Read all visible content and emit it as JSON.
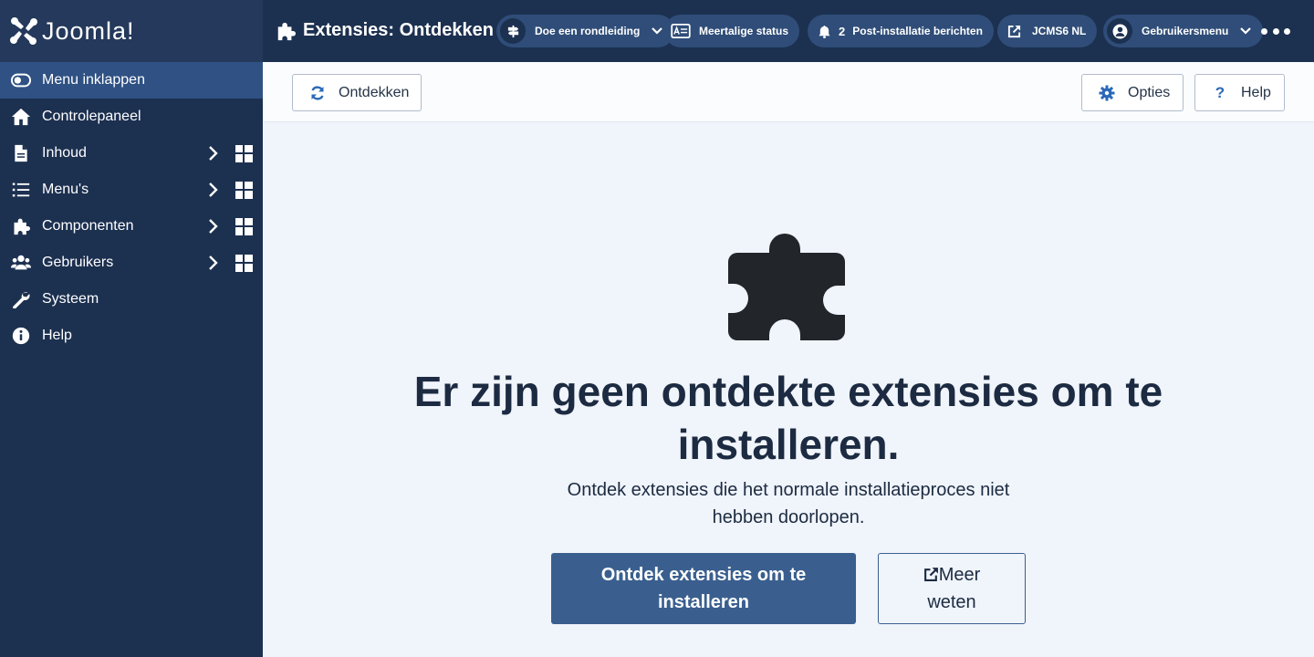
{
  "brand": {
    "name": "Joomla!"
  },
  "sidebar": {
    "items": [
      {
        "label": "Menu inklappen",
        "icon": "toggle-icon"
      },
      {
        "label": "Controlepaneel",
        "icon": "home-icon"
      },
      {
        "label": "Inhoud",
        "icon": "file-icon"
      },
      {
        "label": "Menu's",
        "icon": "list-icon"
      },
      {
        "label": "Componenten",
        "icon": "puzzle-icon"
      },
      {
        "label": "Gebruikers",
        "icon": "users-icon"
      },
      {
        "label": "Systeem",
        "icon": "wrench-icon"
      },
      {
        "label": "Help",
        "icon": "info-icon"
      }
    ]
  },
  "header": {
    "title": "Extensies: Ontdekken",
    "tour_label": "Doe een rondleiding",
    "multilang_label": "Meertalige status",
    "messages_count": "2",
    "messages_label": "Post-installatie berichten",
    "site_label": "JCMS6 NL",
    "user_label": "Gebruikersmenu"
  },
  "toolbar": {
    "discover_label": "Ontdekken",
    "options_label": "Opties",
    "help_label": "Help"
  },
  "empty_state": {
    "title": "Er zijn geen ontdekte extensies om te installeren.",
    "text": "Ontdek extensies die het normale installatieproces niet hebben doorlopen.",
    "primary_label": "Ontdek extensies om te installeren",
    "secondary_label": "Meer weten"
  },
  "colors": {
    "sidebar_bg": "#1c3050",
    "active_item": "#2f5184",
    "primary_button": "#3a5f8f",
    "content_bg": "#f0f4fb"
  }
}
